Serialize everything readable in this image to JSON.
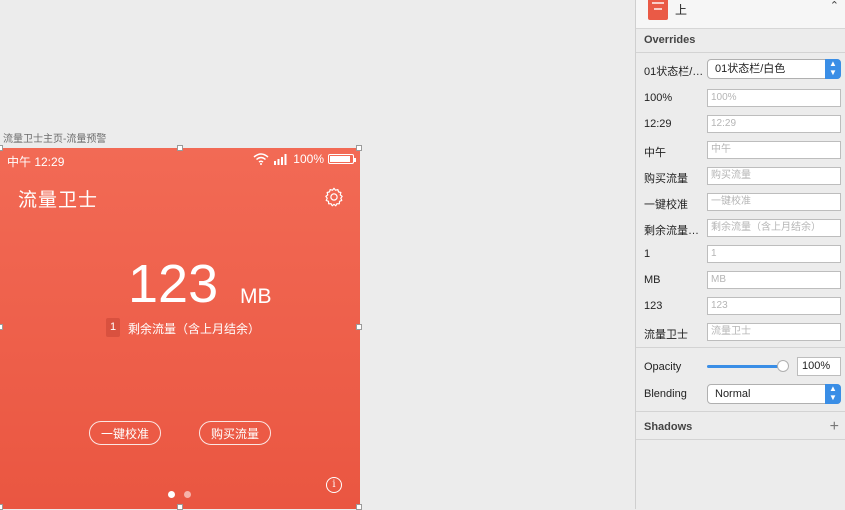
{
  "canvas": {
    "artboard_label": "流量卫士主页-流量预警"
  },
  "phone": {
    "status_left": "中午 12:29",
    "battery_text": "100%",
    "app_title": "流量卫士",
    "big_number": "123",
    "unit": "MB",
    "badge": "1",
    "remaining_label": "剩余流量（含上月结余）",
    "calibrate_button": "一键校准",
    "buy_button": "购买流量",
    "info_symbol": "i"
  },
  "inspector": {
    "symbol_name": "上",
    "overrides_title": "Overrides",
    "status_row": {
      "label": "01状态栏/…",
      "value": "01状态栏/白色"
    },
    "rows": [
      {
        "label": "100%",
        "placeholder": "100%"
      },
      {
        "label": "12:29",
        "placeholder": "12:29"
      },
      {
        "label": "中午",
        "placeholder": "中午"
      },
      {
        "label": "购买流量",
        "placeholder": "购买流量"
      },
      {
        "label": "一键校准",
        "placeholder": "一键校准"
      },
      {
        "label": "剩余流量…",
        "placeholder": "剩余流量（含上月结余）"
      },
      {
        "label": "1",
        "placeholder": "1"
      },
      {
        "label": "MB",
        "placeholder": "MB"
      },
      {
        "label": "123",
        "placeholder": "123"
      },
      {
        "label": "流量卫士",
        "placeholder": "流量卫士"
      }
    ],
    "opacity_label": "Opacity",
    "opacity_value": "100%",
    "blending_label": "Blending",
    "blending_value": "Normal",
    "shadows_title": "Shadows"
  },
  "colors": {
    "artboard_top": "#f26a55",
    "artboard_bottom": "#ea5641",
    "accent": "#3a8ee6"
  }
}
